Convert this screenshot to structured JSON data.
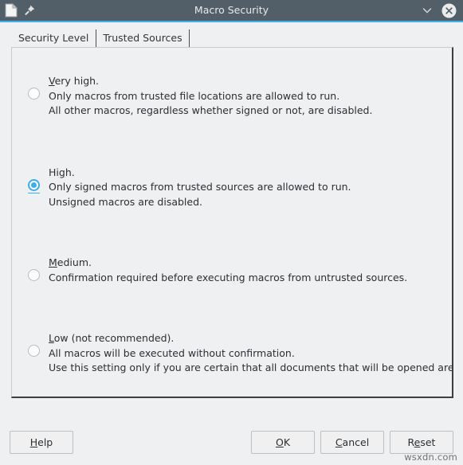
{
  "window": {
    "title": "Macro Security",
    "icons": {
      "document": "document-icon",
      "pin": "pin-icon",
      "chevron_down": "chevron-down-icon",
      "close": "close-icon"
    },
    "colors": {
      "titlebar_bg": "#525e68",
      "accent": "#3daee9",
      "panel_bg": "#eff0f1",
      "text": "#2b2f33"
    }
  },
  "tabs": [
    {
      "label": "Security Level",
      "active": true
    },
    {
      "label": "Trusted Sources",
      "active": false
    }
  ],
  "options": [
    {
      "id": "very-high",
      "selected": false,
      "accel_before": "V",
      "title_pre": "",
      "title_acc": "V",
      "title_post": "ery high.",
      "lines": [
        "Only macros from trusted file locations are allowed to run.",
        "All other macros, regardless whether signed or not, are disabled."
      ]
    },
    {
      "id": "high",
      "selected": true,
      "title_pre": "Hi",
      "title_acc": "g",
      "title_post": "h.",
      "lines": [
        "Only signed macros from trusted sources are allowed to run.",
        "Unsigned macros are disabled."
      ]
    },
    {
      "id": "medium",
      "selected": false,
      "title_pre": "",
      "title_acc": "M",
      "title_post": "edium.",
      "lines": [
        "Confirmation required before executing macros from untrusted sources."
      ]
    },
    {
      "id": "low",
      "selected": false,
      "title_pre": "",
      "title_acc": "L",
      "title_post": "ow (not recommended).",
      "lines": [
        "All macros will be executed without confirmation.",
        "Use this setting only if you are certain that all documents that will be opened are safe."
      ]
    }
  ],
  "buttons": {
    "help": {
      "pre": "",
      "acc": "H",
      "post": "elp"
    },
    "ok": {
      "pre": "",
      "acc": "O",
      "post": "K"
    },
    "cancel": {
      "pre": "",
      "acc": "C",
      "post": "ancel"
    },
    "reset": {
      "pre": "R",
      "acc": "e",
      "post": "set"
    }
  },
  "watermark": "wsxdn.com"
}
